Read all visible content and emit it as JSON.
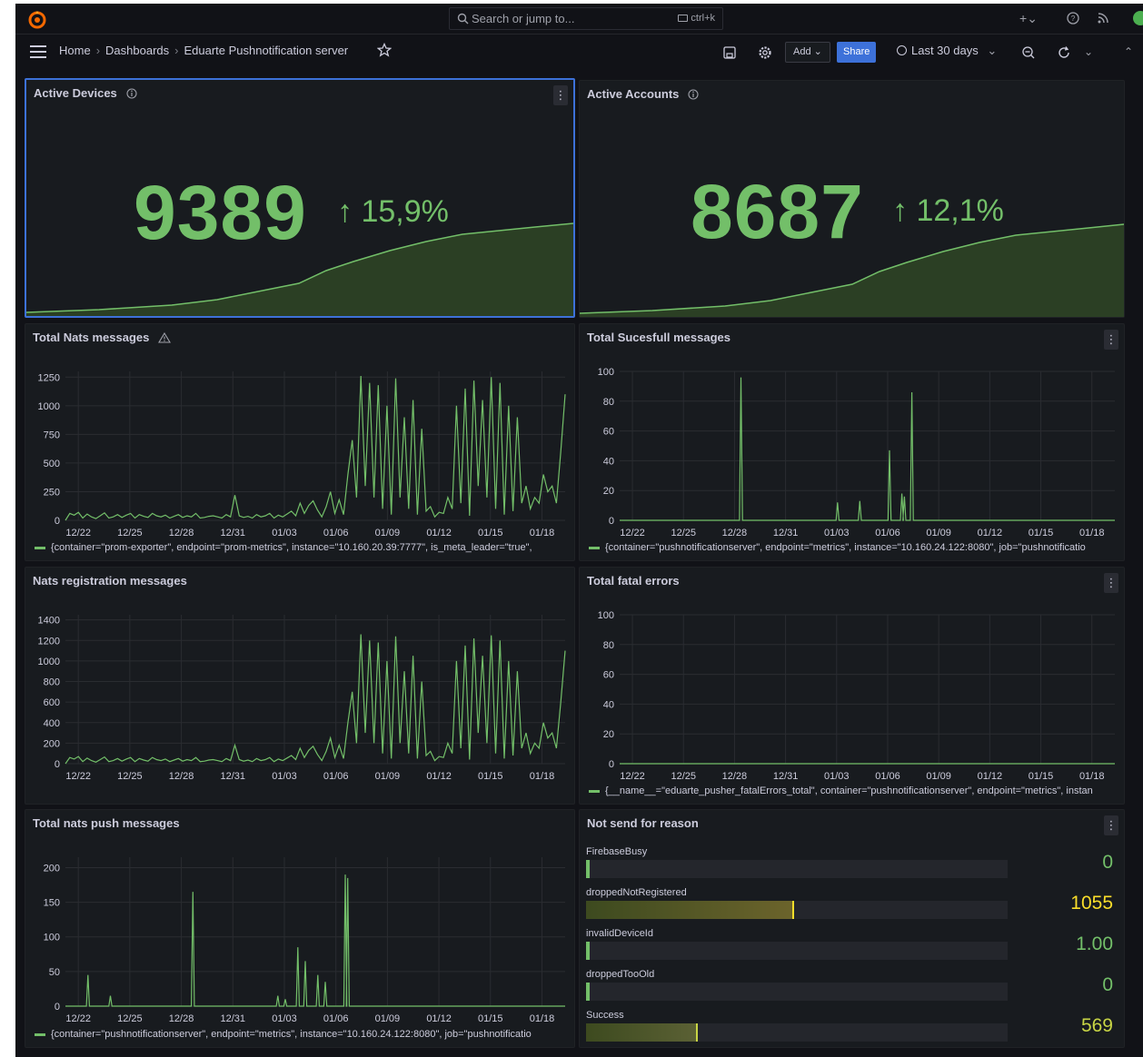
{
  "topbar": {
    "search_placeholder": "Search or jump to...",
    "search_shortcut": "ctrl+k"
  },
  "breadcrumb": {
    "home": "Home",
    "dashboards": "Dashboards",
    "current": "Eduarte Pushnotification server"
  },
  "toolbar": {
    "add_label": "Add",
    "share_label": "Share",
    "time_range": "Last 30 days"
  },
  "panels": {
    "active_devices": {
      "title": "Active Devices",
      "value": "9389",
      "delta": "15,9%"
    },
    "active_accounts": {
      "title": "Active Accounts",
      "value": "8687",
      "delta": "12,1%"
    },
    "total_nats": {
      "title": "Total Nats messages",
      "legend": "{container=\"prom-exporter\", endpoint=\"prom-metrics\", instance=\"10.160.20.39:7777\", is_meta_leader=\"true\","
    },
    "total_successful": {
      "title": "Total Sucesfull messages",
      "legend": "{container=\"pushnotificationserver\", endpoint=\"metrics\", instance=\"10.160.24.122:8080\", job=\"pushnotificatio"
    },
    "nats_registration": {
      "title": "Nats registration messages"
    },
    "total_fatal": {
      "title": "Total fatal errors",
      "legend": "{__name__=\"eduarte_pusher_fatalErrors_total\", container=\"pushnotificationserver\", endpoint=\"metrics\", instan"
    },
    "total_push": {
      "title": "Total nats push messages",
      "legend": "{container=\"pushnotificationserver\", endpoint=\"metrics\", instance=\"10.160.24.122:8080\", job=\"pushnotificatio"
    },
    "not_send": {
      "title": "Not send for reason",
      "rows": [
        {
          "label": "FirebaseBusy",
          "value": "0",
          "fraction": 0.0,
          "color": "#73bf69"
        },
        {
          "label": "droppedNotRegistered",
          "value": "1055",
          "fraction": 0.49,
          "color": "#fade2a"
        },
        {
          "label": "invalidDeviceId",
          "value": "1.00",
          "fraction": 0.0,
          "color": "#73bf69"
        },
        {
          "label": "droppedTooOld",
          "value": "0",
          "fraction": 0.0,
          "color": "#73bf69"
        },
        {
          "label": "Success",
          "value": "569",
          "fraction": 0.26,
          "color": "#c8d545"
        }
      ]
    }
  },
  "colors": {
    "series": "#73bf69",
    "accent": "#3d71d9",
    "background": "#111217",
    "panel": "#181b1f"
  },
  "chart_data": [
    {
      "id": "total_nats",
      "type": "line",
      "title": "Total Nats messages",
      "x_ticks": [
        "12/22",
        "12/25",
        "12/28",
        "12/31",
        "01/03",
        "01/06",
        "01/09",
        "01/12",
        "01/15",
        "01/18"
      ],
      "y_ticks": [
        0,
        250,
        500,
        750,
        1000,
        1250
      ],
      "ylim": [
        0,
        1300
      ],
      "series": [
        {
          "values": [
            0,
            60,
            45,
            70,
            20,
            55,
            30,
            15,
            40,
            65,
            20,
            30,
            50,
            25,
            45,
            60,
            20,
            50,
            35,
            25,
            60,
            40,
            30,
            45,
            20,
            35,
            50,
            25,
            40,
            30,
            60,
            20,
            25,
            35,
            40,
            30,
            20,
            50,
            30,
            220,
            40,
            25,
            35,
            20,
            50,
            30,
            40,
            60,
            20,
            45,
            30,
            55,
            80,
            40,
            150,
            60,
            130,
            170,
            90,
            30,
            120,
            250,
            60,
            180,
            50,
            400,
            700,
            200,
            1260,
            300,
            1200,
            200,
            1180,
            100,
            1000,
            50,
            1240,
            200,
            900,
            100,
            1050,
            50,
            800,
            80,
            120,
            30,
            70,
            60,
            200,
            100,
            1000,
            150,
            1150,
            40,
            1220,
            300,
            1050,
            200,
            1250,
            100,
            1200,
            50,
            1000,
            80,
            900,
            150,
            300,
            100,
            200,
            150,
            400,
            250,
            300,
            150,
            600,
            1100
          ]
        }
      ]
    },
    {
      "id": "total_successful",
      "type": "line",
      "title": "Total Sucesfull messages",
      "x_ticks": [
        "12/22",
        "12/25",
        "12/28",
        "12/31",
        "01/03",
        "01/06",
        "01/09",
        "01/12",
        "01/15",
        "01/18"
      ],
      "y_ticks": [
        0,
        20,
        40,
        60,
        80,
        100
      ],
      "ylim": [
        0,
        100
      ],
      "series": [
        {
          "spikes": [
            [
              0.245,
              96
            ],
            [
              0.44,
              12
            ],
            [
              0.485,
              13
            ],
            [
              0.545,
              47
            ],
            [
              0.57,
              18
            ],
            [
              0.575,
              16
            ],
            [
              0.59,
              86
            ]
          ]
        }
      ]
    },
    {
      "id": "nats_registration",
      "type": "line",
      "title": "Nats registration messages",
      "x_ticks": [
        "12/22",
        "12/25",
        "12/28",
        "12/31",
        "01/03",
        "01/06",
        "01/09",
        "01/12",
        "01/15",
        "01/18"
      ],
      "y_ticks": [
        0,
        200,
        400,
        600,
        800,
        1000,
        1200,
        1400
      ],
      "ylim": [
        0,
        1450
      ],
      "series": [
        {
          "values": [
            0,
            60,
            45,
            70,
            20,
            55,
            30,
            15,
            40,
            65,
            20,
            30,
            50,
            25,
            45,
            60,
            20,
            50,
            35,
            25,
            60,
            40,
            30,
            45,
            20,
            35,
            50,
            25,
            40,
            30,
            60,
            20,
            25,
            35,
            40,
            30,
            20,
            50,
            30,
            180,
            40,
            25,
            35,
            20,
            50,
            30,
            40,
            60,
            20,
            45,
            30,
            55,
            80,
            40,
            150,
            60,
            130,
            170,
            90,
            30,
            120,
            250,
            60,
            180,
            50,
            400,
            700,
            200,
            1260,
            300,
            1200,
            200,
            1180,
            100,
            1000,
            50,
            1240,
            200,
            900,
            100,
            1050,
            50,
            800,
            80,
            120,
            30,
            70,
            60,
            200,
            100,
            1000,
            150,
            1150,
            40,
            1220,
            300,
            1050,
            200,
            1250,
            100,
            1200,
            50,
            1000,
            80,
            900,
            150,
            300,
            100,
            200,
            150,
            400,
            250,
            300,
            150,
            600,
            1100
          ]
        }
      ]
    },
    {
      "id": "total_fatal",
      "type": "line",
      "title": "Total fatal errors",
      "x_ticks": [
        "12/22",
        "12/25",
        "12/28",
        "12/31",
        "01/03",
        "01/06",
        "01/09",
        "01/12",
        "01/15",
        "01/18"
      ],
      "y_ticks": [
        0,
        20,
        40,
        60,
        80,
        100
      ],
      "ylim": [
        0,
        100
      ],
      "series": [
        {
          "constant": 0
        }
      ]
    },
    {
      "id": "total_push",
      "type": "line",
      "title": "Total nats push messages",
      "x_ticks": [
        "12/22",
        "12/25",
        "12/28",
        "12/31",
        "01/03",
        "01/06",
        "01/09",
        "01/12",
        "01/15",
        "01/18"
      ],
      "y_ticks": [
        0,
        50,
        100,
        150,
        200
      ],
      "ylim": [
        0,
        215
      ],
      "series": [
        {
          "spikes": [
            [
              0.045,
              45
            ],
            [
              0.09,
              15
            ],
            [
              0.255,
              165
            ],
            [
              0.425,
              15
            ],
            [
              0.44,
              10
            ],
            [
              0.465,
              85
            ],
            [
              0.48,
              65
            ],
            [
              0.505,
              45
            ],
            [
              0.52,
              35
            ],
            [
              0.56,
              190
            ],
            [
              0.565,
              185
            ]
          ]
        }
      ]
    }
  ]
}
